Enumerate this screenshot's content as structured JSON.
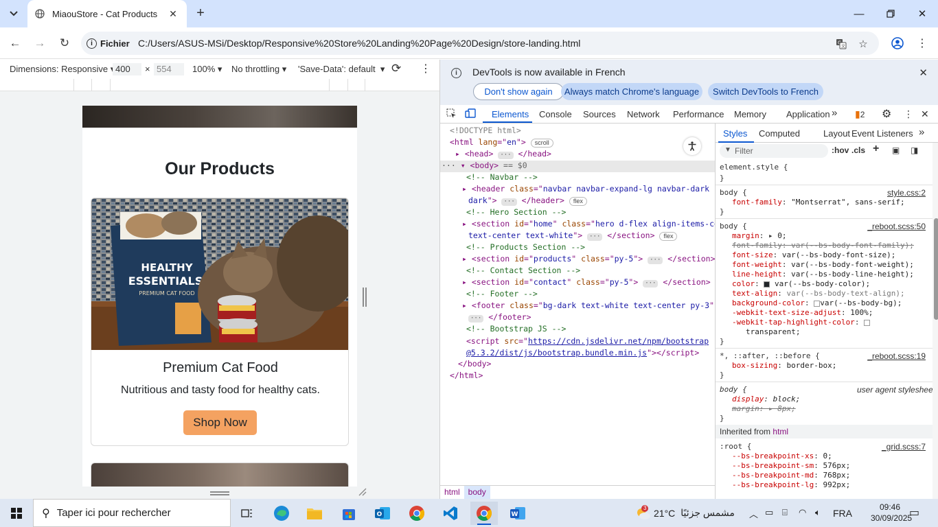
{
  "browser": {
    "tab_title": "MiaouStore - Cat Products",
    "omnibox_chip": "Fichier",
    "url": "C:/Users/ASUS-MSi/Desktop/Responsive%20Store%20Landing%20Page%20Design/store-landing.html"
  },
  "device_toolbar": {
    "dimensions_label": "Dimensions: Responsive",
    "width": "400",
    "height": "554",
    "zoom": "100%",
    "throttling": "No throttling",
    "save_data": "'Save-Data': default"
  },
  "page": {
    "section_title": "Our Products",
    "card": {
      "title": "Premium Cat Food",
      "text": "Nutritious and tasty food for healthy cats.",
      "button": "Shop Now",
      "image_bag_brand": "HEALTHY",
      "image_bag_brand2": "ESSENTIALS",
      "image_bag_sub": "PREMIUM CAT FOOD"
    }
  },
  "devtools": {
    "infobar": {
      "message": "DevTools is now available in French",
      "btn_dont_show": "Don't show again",
      "btn_match": "Always match Chrome's language",
      "btn_switch": "Switch DevTools to French"
    },
    "tabs": [
      "Elements",
      "Console",
      "Sources",
      "Network",
      "Performance",
      "Memory",
      "Application"
    ],
    "issues_count": "2",
    "elements": {
      "doctype": "<!DOCTYPE html>",
      "scroll_pill": "scroll",
      "flex_pill": "flex",
      "body_suffix": "== $0",
      "comments": [
        "<!-- Navbar -->",
        "<!-- Hero Section -->",
        "<!-- Products Section -->",
        "<!-- Contact Section -->",
        "<!-- Footer -->",
        "<!-- Bootstrap JS -->"
      ],
      "header_class": "navbar navbar-expand-lg navbar-dark bg-dark",
      "hero_id": "home",
      "hero_class": "hero d-flex align-items-center text-center text-white",
      "products_id": "products",
      "products_class": "py-5",
      "contact_id": "contact",
      "contact_class": "py-5",
      "footer_class": "bg-dark text-white text-center py-3",
      "script_src": "https://cdn.jsdelivr.net/npm/bootstrap@5.3.2/dist/js/bootstrap.bundle.min.js"
    },
    "breadcrumbs": [
      "html",
      "body"
    ],
    "styles": {
      "tabs": [
        "Styles",
        "Computed",
        "Layout",
        "Event Listeners"
      ],
      "filter_placeholder": "Filter",
      "hov": ":hov",
      "cls": ".cls",
      "element_style": "element.style {",
      "inherited_from": "Inherited from",
      "inherited_tag": "html",
      "sources": {
        "style_css": "style.css:2",
        "reboot50": "_reboot.scss:50",
        "reboot19": "_reboot.scss:19",
        "user_agent": "user agent stylesheet",
        "grid7": "_grid.scss:7"
      }
    }
  },
  "taskbar": {
    "search_placeholder": "Taper ici pour rechercher",
    "weather_temp": "21°C",
    "weather_text": "مشمس جزئيًا",
    "weather_badge": "3",
    "language": "FRA",
    "time": "09:46",
    "date": "30/09/2025"
  }
}
